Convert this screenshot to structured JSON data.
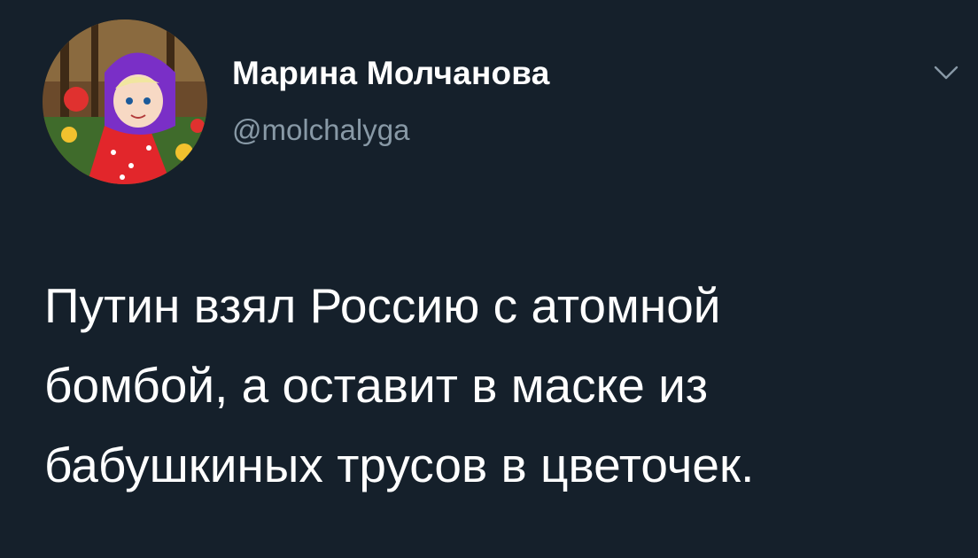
{
  "tweet": {
    "author": {
      "display_name": "Марина Молчанова",
      "handle": "@molchalyga",
      "avatar_icon": "cartoon-girl-avatar"
    },
    "menu_icon": "chevron-down-icon",
    "text_lines": [
      "Путин взял Россию с атомной",
      "бомбой, а оставит в маске из",
      "бабушкиных трусов в цветочек."
    ]
  },
  "colors": {
    "background": "#15202b",
    "primary_text": "#ffffff",
    "secondary_text": "#8899a6"
  }
}
